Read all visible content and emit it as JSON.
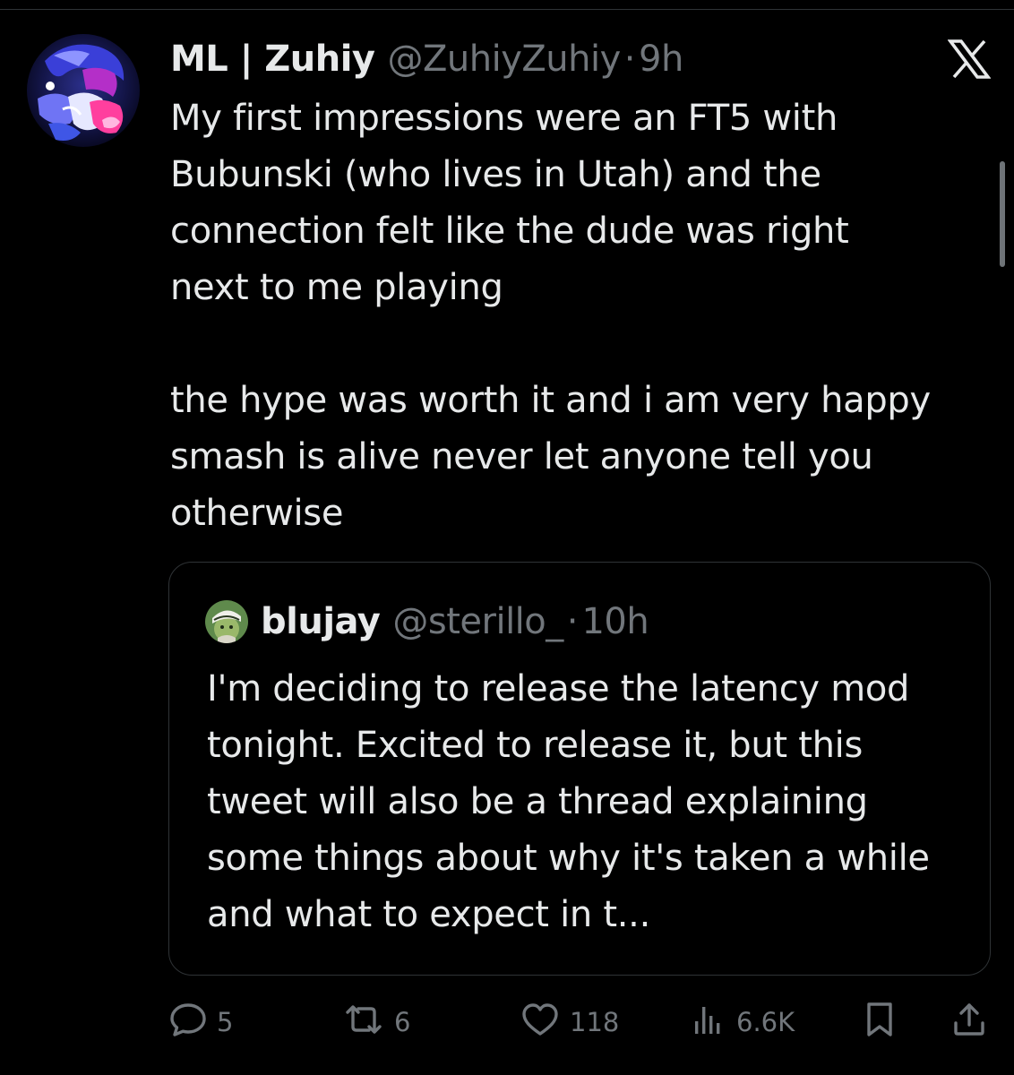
{
  "tweet": {
    "display_name": "ML | Zuhiy",
    "handle": "@ZuhiyZuhiy",
    "separator": "·",
    "time": "9h",
    "text": "My first impressions were an FT5 with\nBubunski (who lives in Utah) and the\nconnection felt like the dude was right\nnext to me playing\n\nthe hype was worth it and i am very happy\nsmash is alive never let anyone tell you\notherwise"
  },
  "quote": {
    "display_name": "blujay",
    "handle": "@sterillo_",
    "separator": "·",
    "time": "10h",
    "text": "I'm deciding to release the latency mod tonight. Excited to release it, but this tweet will also be a thread explaining some things about why it's taken a while and what to expect in t..."
  },
  "actions": {
    "replies": "5",
    "reposts": "6",
    "likes": "118",
    "views": "6.6K"
  },
  "icons": {
    "brand": "x-logo-icon",
    "reply": "reply-icon",
    "repost": "repost-icon",
    "like": "heart-icon",
    "views": "views-icon",
    "bookmark": "bookmark-icon",
    "share": "share-icon"
  },
  "colors": {
    "background": "#000000",
    "text_primary": "#e7e9ea",
    "text_secondary": "#71767b",
    "border": "#2f3336"
  }
}
